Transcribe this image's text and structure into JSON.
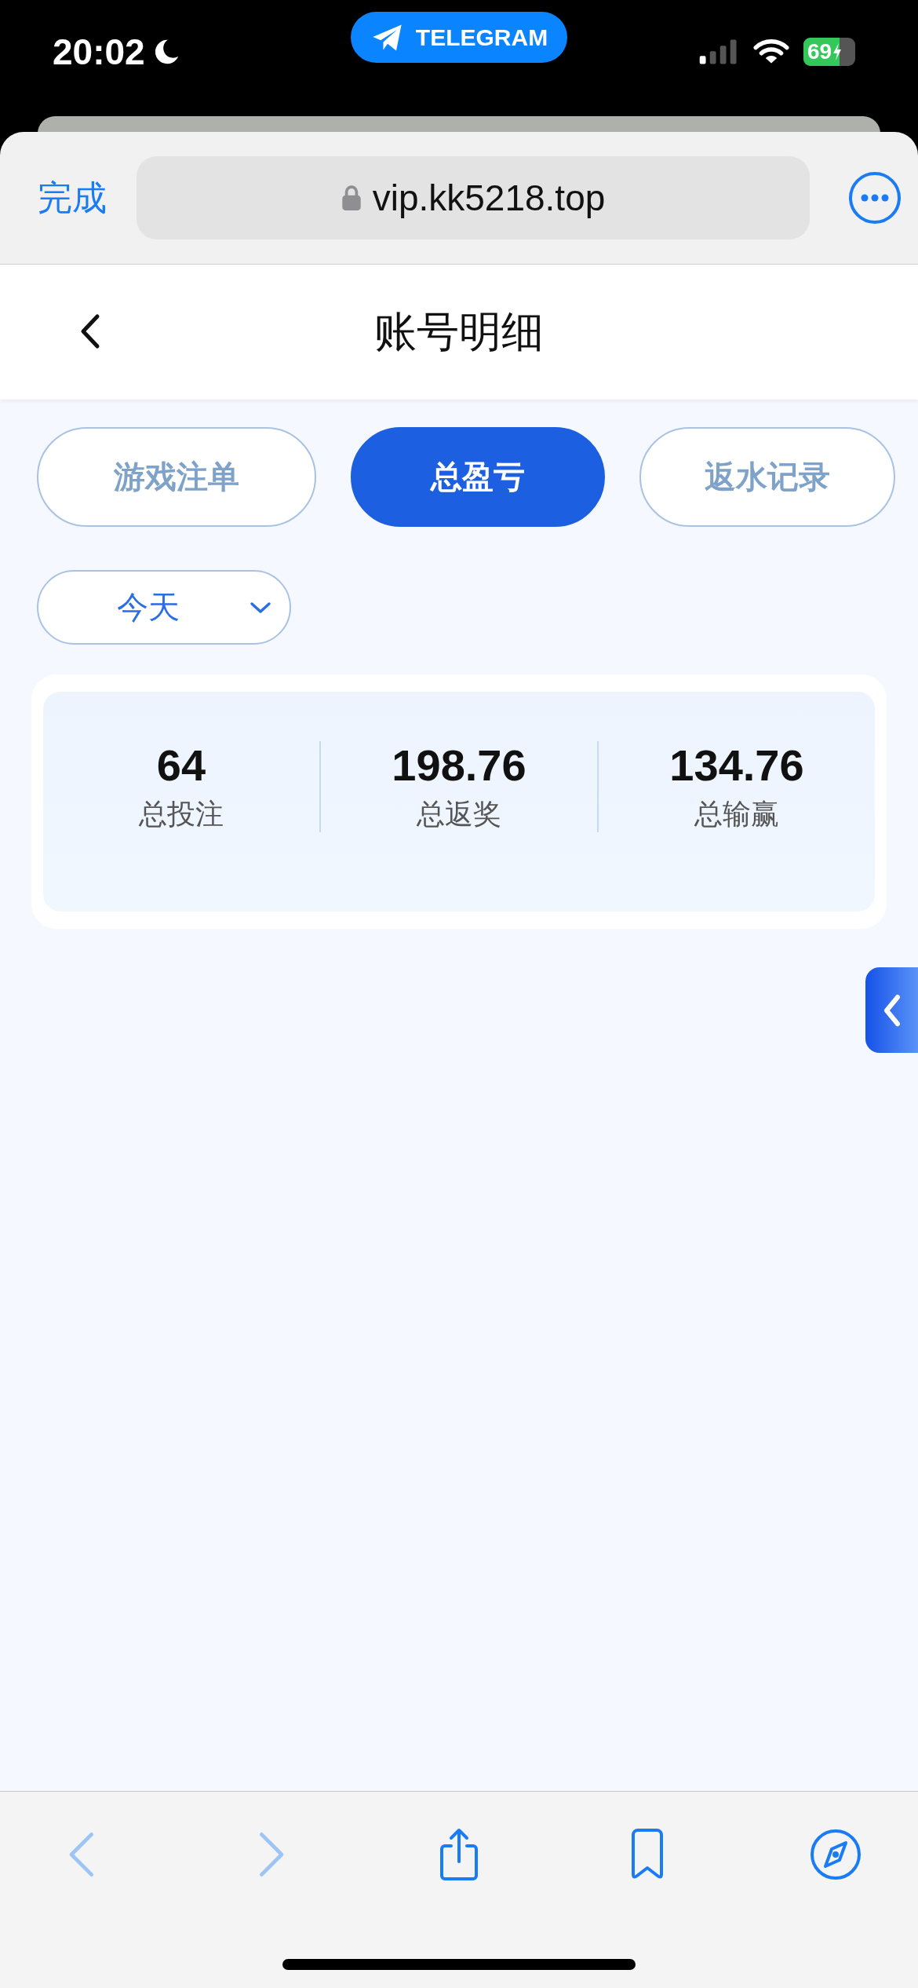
{
  "status_bar": {
    "time": "20:02",
    "app_pill": "TELEGRAM",
    "battery": {
      "text": "69",
      "level": 0.69,
      "charging": true
    }
  },
  "browser": {
    "done": "完成",
    "url": "vip.kk5218.top"
  },
  "header": {
    "title": "账号明细"
  },
  "tabs": [
    {
      "label": "游戏注单",
      "selected": false
    },
    {
      "label": "总盈亏",
      "selected": true
    },
    {
      "label": "返水记录",
      "selected": false
    }
  ],
  "period_select": {
    "value": "今天"
  },
  "stats": [
    {
      "value": "64",
      "label": "总投注"
    },
    {
      "value": "198.76",
      "label": "总返奖"
    },
    {
      "value": "134.76",
      "label": "总输赢"
    }
  ],
  "toolbar": {
    "back_disabled": true,
    "forward_disabled": true
  }
}
